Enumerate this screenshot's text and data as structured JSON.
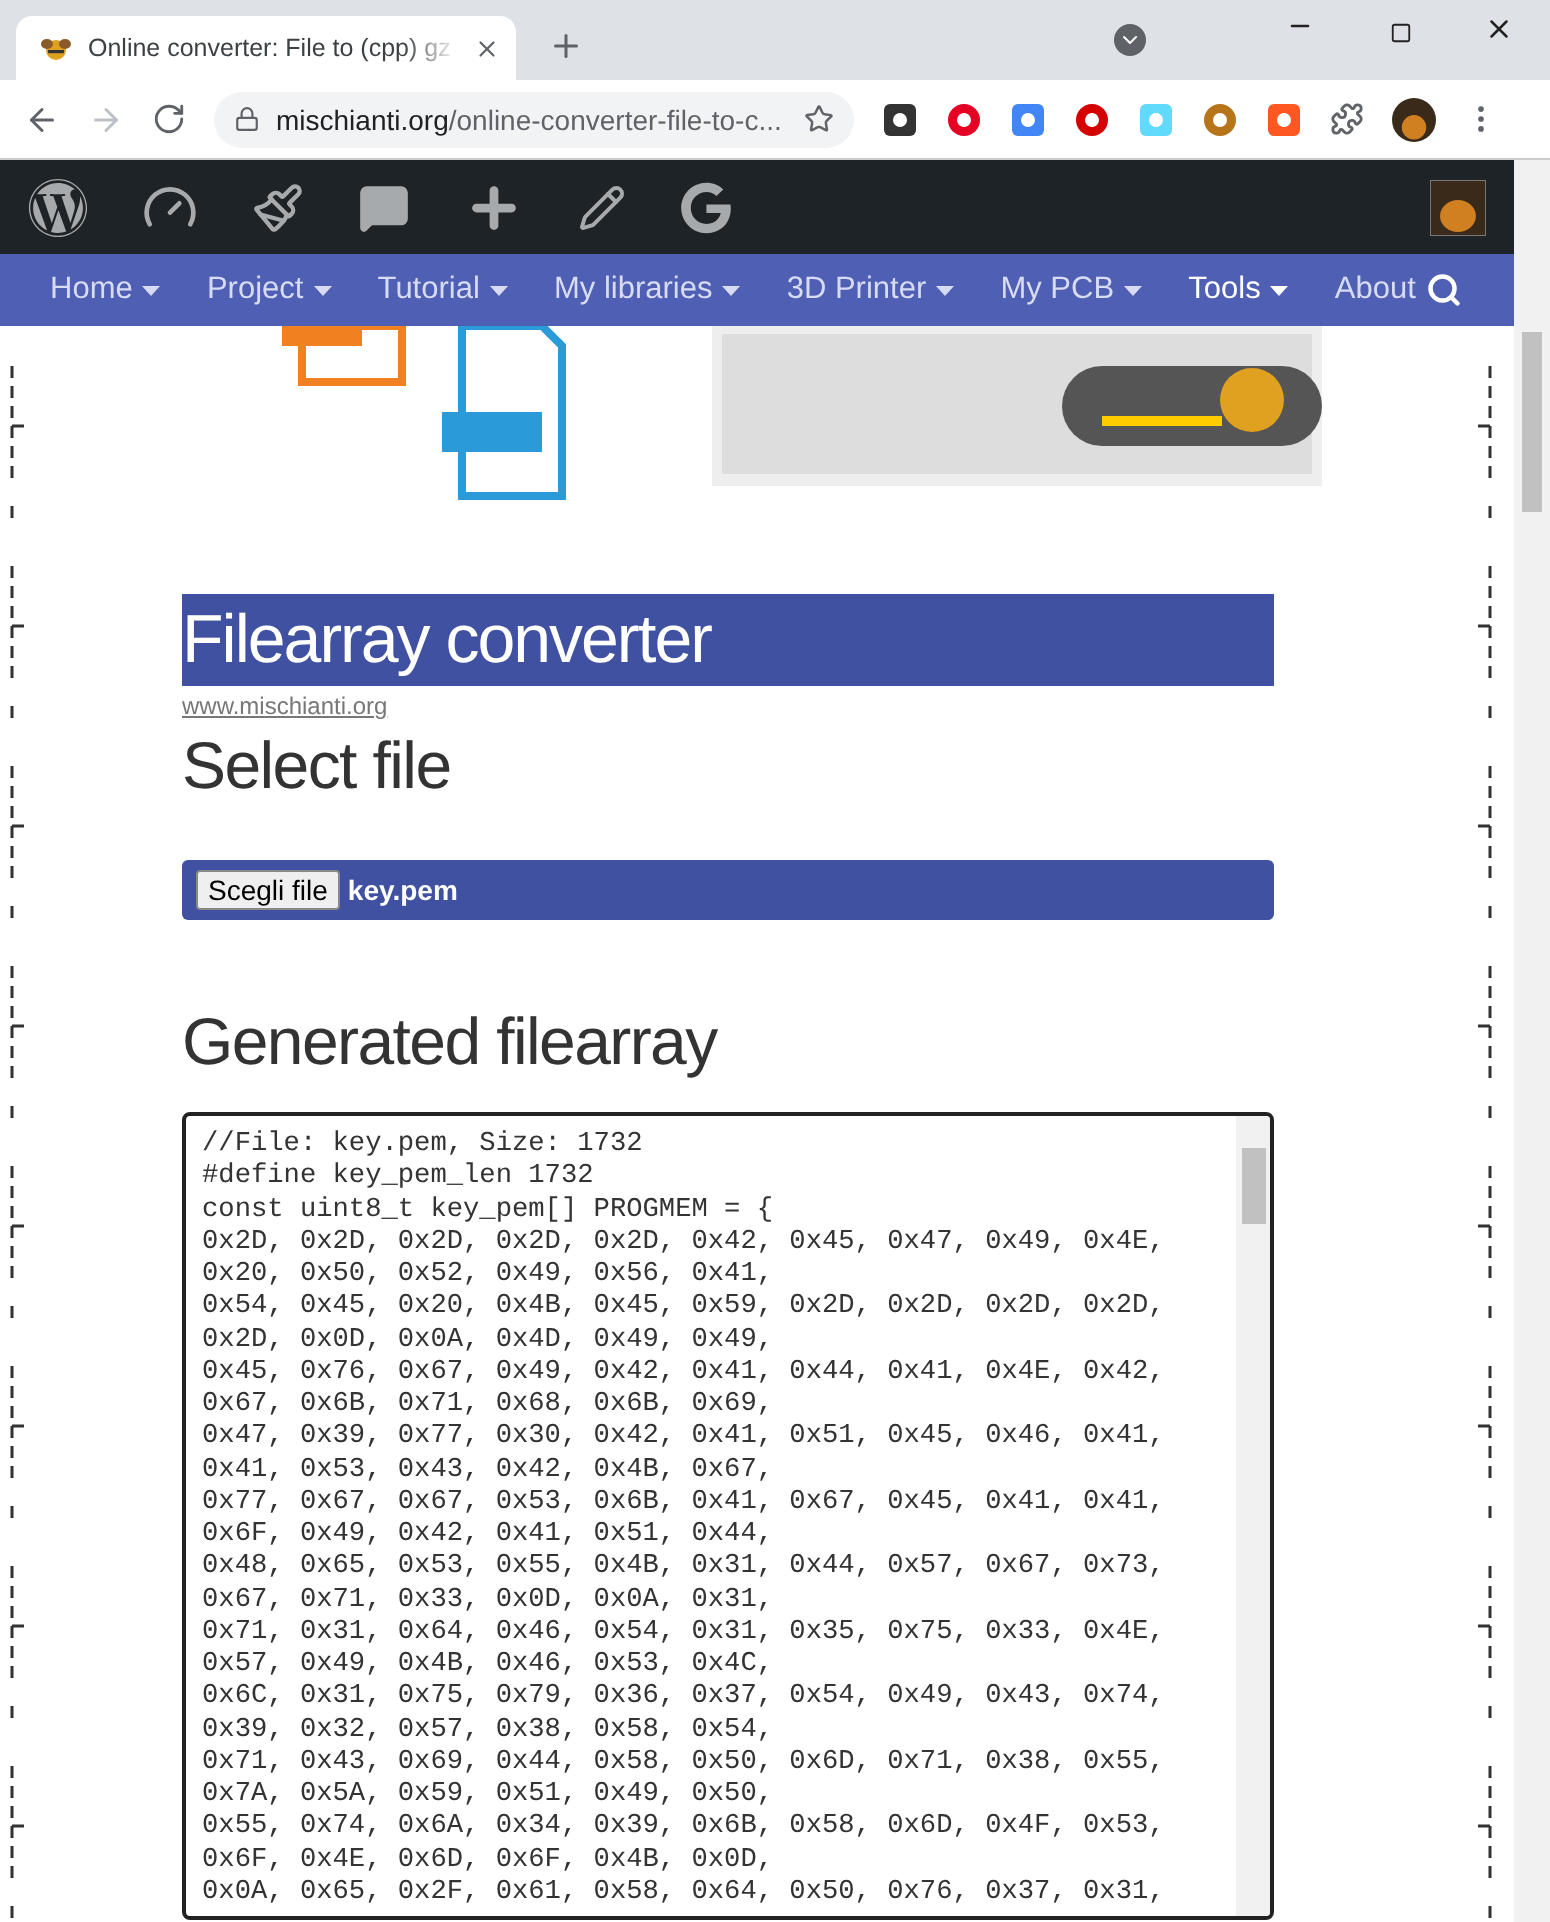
{
  "browser": {
    "tab": {
      "title": "Online converter: File to (cpp) gz"
    },
    "nav_buttons": [
      {
        "kind": "back",
        "disabled": false
      },
      {
        "kind": "forward",
        "disabled": true
      },
      {
        "kind": "reload",
        "disabled": false
      }
    ],
    "address": {
      "host": "mischianti.org",
      "path": "/online-converter-file-to-c..."
    }
  },
  "nav": {
    "items": [
      {
        "label": "Home",
        "selected": false
      },
      {
        "label": "Project",
        "selected": false
      },
      {
        "label": "Tutorial",
        "selected": false
      },
      {
        "label": "My libraries",
        "selected": false
      },
      {
        "label": "3D Printer",
        "selected": false
      },
      {
        "label": "My PCB",
        "selected": false
      },
      {
        "label": "Tools",
        "selected": true
      },
      {
        "label": "About",
        "selected": false
      }
    ]
  },
  "page": {
    "title": "Filearray converter",
    "link": "www.mischianti.org",
    "select_heading": "Select file",
    "file_button": "Scegli file",
    "file_name": "key.pem",
    "output_heading": "Generated filearray",
    "code_lines": [
      "//File: key.pem, Size: 1732",
      "#define key_pem_len 1732",
      "const uint8_t key_pem[] PROGMEM = {",
      "0x2D, 0x2D, 0x2D, 0x2D, 0x2D, 0x42, 0x45, 0x47, 0x49, 0x4E,",
      "0x20, 0x50, 0x52, 0x49, 0x56, 0x41,",
      "0x54, 0x45, 0x20, 0x4B, 0x45, 0x59, 0x2D, 0x2D, 0x2D, 0x2D,",
      "0x2D, 0x0D, 0x0A, 0x4D, 0x49, 0x49,",
      "0x45, 0x76, 0x67, 0x49, 0x42, 0x41, 0x44, 0x41, 0x4E, 0x42,",
      "0x67, 0x6B, 0x71, 0x68, 0x6B, 0x69,",
      "0x47, 0x39, 0x77, 0x30, 0x42, 0x41, 0x51, 0x45, 0x46, 0x41,",
      "0x41, 0x53, 0x43, 0x42, 0x4B, 0x67,",
      "0x77, 0x67, 0x67, 0x53, 0x6B, 0x41, 0x67, 0x45, 0x41, 0x41,",
      "0x6F, 0x49, 0x42, 0x41, 0x51, 0x44,",
      "0x48, 0x65, 0x53, 0x55, 0x4B, 0x31, 0x44, 0x57, 0x67, 0x73,",
      "0x67, 0x71, 0x33, 0x0D, 0x0A, 0x31,",
      "0x71, 0x31, 0x64, 0x46, 0x54, 0x31, 0x35, 0x75, 0x33, 0x4E,",
      "0x57, 0x49, 0x4B, 0x46, 0x53, 0x4C,",
      "0x6C, 0x31, 0x75, 0x79, 0x36, 0x37, 0x54, 0x49, 0x43, 0x74,",
      "0x39, 0x32, 0x57, 0x38, 0x58, 0x54,",
      "0x71, 0x43, 0x69, 0x44, 0x58, 0x50, 0x6D, 0x71, 0x38, 0x55,",
      "0x7A, 0x5A, 0x59, 0x51, 0x49, 0x50,",
      "0x55, 0x74, 0x6A, 0x34, 0x39, 0x6B, 0x58, 0x6D, 0x4F, 0x53,",
      "0x6F, 0x4E, 0x6D, 0x6F, 0x4B, 0x0D,",
      "0x0A, 0x65, 0x2F, 0x61, 0x58, 0x64, 0x50, 0x76, 0x37, 0x31,"
    ]
  }
}
